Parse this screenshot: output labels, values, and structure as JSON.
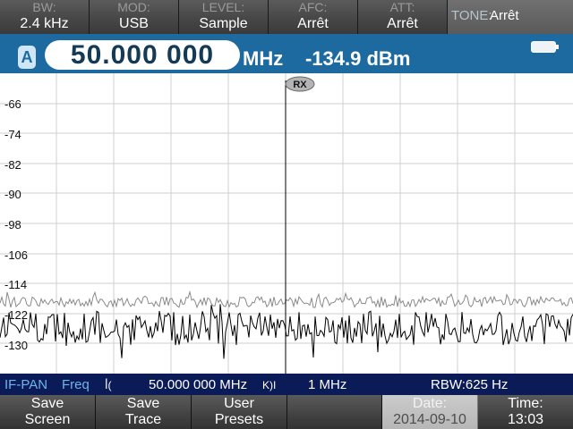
{
  "top_bar": {
    "tiles": [
      {
        "label": "BW:",
        "value": "2.4 kHz"
      },
      {
        "label": "MOD:",
        "value": "USB"
      },
      {
        "label": "LEVEL:",
        "value": "Sample"
      },
      {
        "label": "AFC:",
        "value": "Arrêt"
      },
      {
        "label": "ATT:",
        "value": "Arrêt"
      }
    ],
    "tone": {
      "label": "TONE:",
      "value": "Arrêt"
    }
  },
  "freq_row": {
    "vfo": "A",
    "frequency": "50.000 000",
    "unit": "MHz",
    "level": "-134.9 dBm"
  },
  "spectrum": {
    "marker_label": "RX",
    "y_ticks": [
      "-66",
      "-74",
      "-82",
      "-90",
      "-98",
      "-106",
      "-114",
      "-122",
      "-130"
    ],
    "trace_max_color": "#8a8a8a",
    "trace_live_color": "#000000",
    "grid_color": "#cfcfcf"
  },
  "status_bar": {
    "mode": "IF-PAN",
    "freq_label": "Freq",
    "center_icon": "ꟾ(",
    "center_freq": "50.000 000 MHz",
    "span_icon": "K)I",
    "span": "1 MHz",
    "rbw": "RBW:625 Hz"
  },
  "softkeys": [
    {
      "l1": "Save",
      "l2": "Screen"
    },
    {
      "l1": "Save",
      "l2": "Trace"
    },
    {
      "l1": "User",
      "l2": "Presets"
    },
    {
      "l1": "",
      "l2": ""
    },
    {
      "l1": "Date:",
      "l2": "2014-09-10"
    },
    {
      "l1": "Time:",
      "l2": "13:03"
    }
  ],
  "icons": {
    "battery": "battery-icon"
  }
}
